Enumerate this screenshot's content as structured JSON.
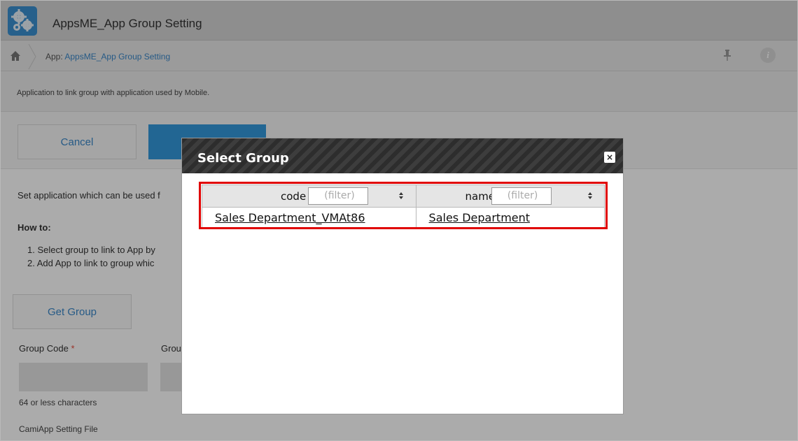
{
  "app": {
    "title": "AppsME_App Group Setting",
    "icon": "gears-icon",
    "accent": "#3b8fd0"
  },
  "breadcrumb": {
    "prefix": "App: ",
    "link": "AppsME_App Group Setting"
  },
  "description": "Application to link group with application used by Mobile.",
  "actions": {
    "cancel": "Cancel"
  },
  "form": {
    "intro": "Set application which can be used f",
    "how_to": "How to:",
    "step1": "1. Select group to link to App by",
    "step2": "2. Add App to link to group whic",
    "get_group": "Get Group",
    "group_code_label": "Group Code",
    "required_mark": "*",
    "group_name_label": "Grou",
    "char_hint": "64 or less characters",
    "setting_file_label": "CamiApp Setting File"
  },
  "dialog": {
    "title": "Select Group",
    "close": "×",
    "columns": [
      {
        "label": "code",
        "filter_placeholder": "(filter)"
      },
      {
        "label": "name",
        "filter_placeholder": "(filter)"
      }
    ],
    "rows": [
      {
        "code": "Sales Department_VMAt86",
        "name": "Sales Department"
      }
    ]
  },
  "colors": {
    "highlight": "#e00000",
    "link": "#3a87c8",
    "save": "#3498db",
    "required": "#e74c3c"
  }
}
